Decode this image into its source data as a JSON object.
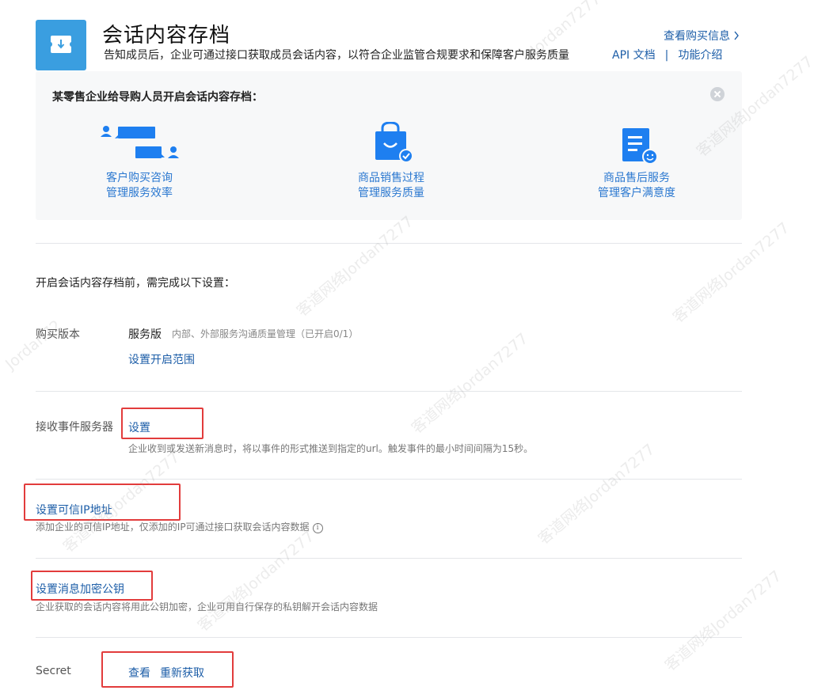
{
  "header": {
    "title": "会话内容存档",
    "subtitle": "告知成员后，企业可通过接口获取成员会话内容，以符合企业监管合规要求和保障客户服务质量",
    "buy_info_link": "查看购买信息",
    "api_doc_link": "API 文档",
    "separator": "|",
    "feature_link": "功能介绍"
  },
  "promo": {
    "title": "某零售企业给导购人员开启会话内容存档：",
    "features": [
      {
        "line1": "客户购买咨询",
        "line2": "管理服务效率",
        "icon": "chat-users-icon"
      },
      {
        "line1": "商品销售过程",
        "line2": "管理服务质量",
        "icon": "shopping-bag-icon"
      },
      {
        "line1": "商品售后服务",
        "line2": "管理客户满意度",
        "icon": "document-smile-icon"
      }
    ]
  },
  "settings": {
    "intro": "开启会话内容存档前，需完成以下设置：",
    "version": {
      "label": "购买版本",
      "name": "服务版",
      "desc": "内部、外部服务沟通质量管理（已开启0/1）",
      "scope_link": "设置开启范围"
    },
    "event_server": {
      "label": "接收事件服务器",
      "link": "设置",
      "desc": "企业收到或发送新消息时，将以事件的形式推送到指定的url。触发事件的最小时间间隔为15秒。"
    },
    "trusted_ip": {
      "link": "设置可信IP地址",
      "desc": "添加企业的可信IP地址，仅添加的IP可通过接口获取会话内容数据"
    },
    "encrypt_key": {
      "link": "设置消息加密公钥",
      "desc": "企业获取的会话内容将用此公钥加密，企业可用自行保存的私钥解开会话内容数据"
    },
    "secret": {
      "label": "Secret",
      "view_link": "查看",
      "regain_link": "重新获取"
    }
  },
  "watermark": {
    "text": "客道网络Jordan7277",
    "fragments": [
      "Jordan7277",
      "Jordan72"
    ]
  },
  "colors": {
    "link": "#1d5ea8",
    "feature_caption": "#2b78d0",
    "icon_blue": "#1e7ff0",
    "highlight_box": "#e23c3c"
  }
}
